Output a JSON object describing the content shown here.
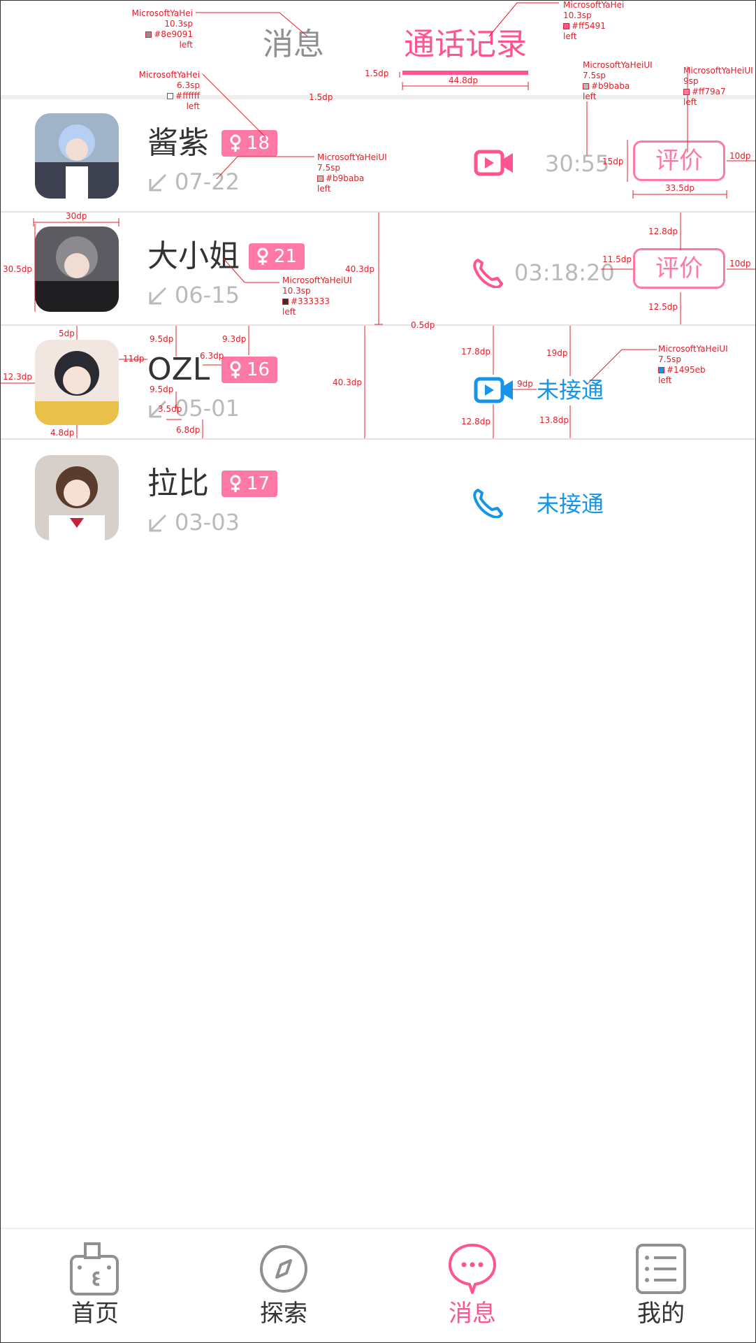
{
  "colors": {
    "accent": "#ff5491",
    "badge": "#ff79a7",
    "tab_inactive": "#8e9091",
    "muted": "#b9baba",
    "missed": "#1495eb",
    "name": "#333333"
  },
  "header": {
    "tabs": [
      {
        "label": "消息",
        "active": false
      },
      {
        "label": "通话记录",
        "active": true
      }
    ]
  },
  "calls": [
    {
      "name": "酱紫",
      "age": "18",
      "date": "07-22",
      "call_type": "video",
      "status_text": "30:55",
      "missed": false,
      "rate_label": "评价"
    },
    {
      "name": "大小姐",
      "age": "21",
      "date": "06-15",
      "call_type": "voice",
      "status_text": "03:18:20",
      "missed": false,
      "rate_label": "评价"
    },
    {
      "name": "OZL",
      "age": "16",
      "date": "05-01",
      "call_type": "video",
      "status_text": "未接通",
      "missed": true,
      "rate_label": ""
    },
    {
      "name": "拉比",
      "age": "17",
      "date": "03-03",
      "call_type": "voice",
      "status_text": "未接通",
      "missed": true,
      "rate_label": ""
    }
  ],
  "annotations": {
    "tab_msg_spec": [
      "MicrosoftYaHei",
      "10.3sp",
      "#8e9091",
      "left"
    ],
    "tab_calls_spec": [
      "MicrosoftYaHei",
      "10.3sp",
      "#ff5491",
      "left"
    ],
    "underline_h": "1.5dp",
    "underline_w": "44.8dp",
    "sep_h": "1.5dp",
    "badge_spec": [
      "MicrosoftYaHei",
      "6.3sp",
      "#ffffff",
      "left"
    ],
    "date_spec": [
      "MicrosoftYaHeiUI",
      "7.5sp",
      "#b9baba",
      "left"
    ],
    "duration_spec": [
      "MicrosoftYaHeiUI",
      "7.5sp",
      "#b9baba",
      "left"
    ],
    "rate_spec": [
      "MicrosoftYaHeiUI",
      "9sp",
      "#ff79a7",
      "left"
    ],
    "name_spec": [
      "MicrosoftYaHeiUI",
      "10.3sp",
      "#333333",
      "left"
    ],
    "missed_spec": [
      "MicrosoftYaHeiUI",
      "7.5sp",
      "#1495eb",
      "left"
    ],
    "dims": {
      "btn_h": "15dp",
      "btn_margin": "10dp",
      "btn_w": "33.5dp",
      "avatar_w": "30dp",
      "avatar_h": "30.5dp",
      "row_h": "40.3dp",
      "btn_top": "12.8dp",
      "btn_gap": "11.5dp",
      "btn_margin2": "10dp",
      "btn_bottom": "12.5dp",
      "line_w": "0.5dp",
      "av_top": "5dp",
      "av_gap": "11dp",
      "av_left": "12.3dp",
      "av_bottom": "4.8dp",
      "name_top": "9.5dp",
      "badge_top": "9.3dp",
      "name_badge": "6.3dp",
      "name_bottom": "9.5dp",
      "icon_gap": "3.5dp",
      "date_bottom": "6.8dp",
      "row_h2": "40.3dp",
      "icon_top": "17.8dp",
      "icon_text": "9dp",
      "icon_bottom": "12.8dp",
      "text_top": "19dp",
      "text_bottom": "13.8dp"
    }
  },
  "nav": [
    {
      "label": "首页",
      "icon": "home-icon",
      "active": false
    },
    {
      "label": "探索",
      "icon": "compass-icon",
      "active": false
    },
    {
      "label": "消息",
      "icon": "message-icon",
      "active": true
    },
    {
      "label": "我的",
      "icon": "list-icon",
      "active": false
    }
  ]
}
